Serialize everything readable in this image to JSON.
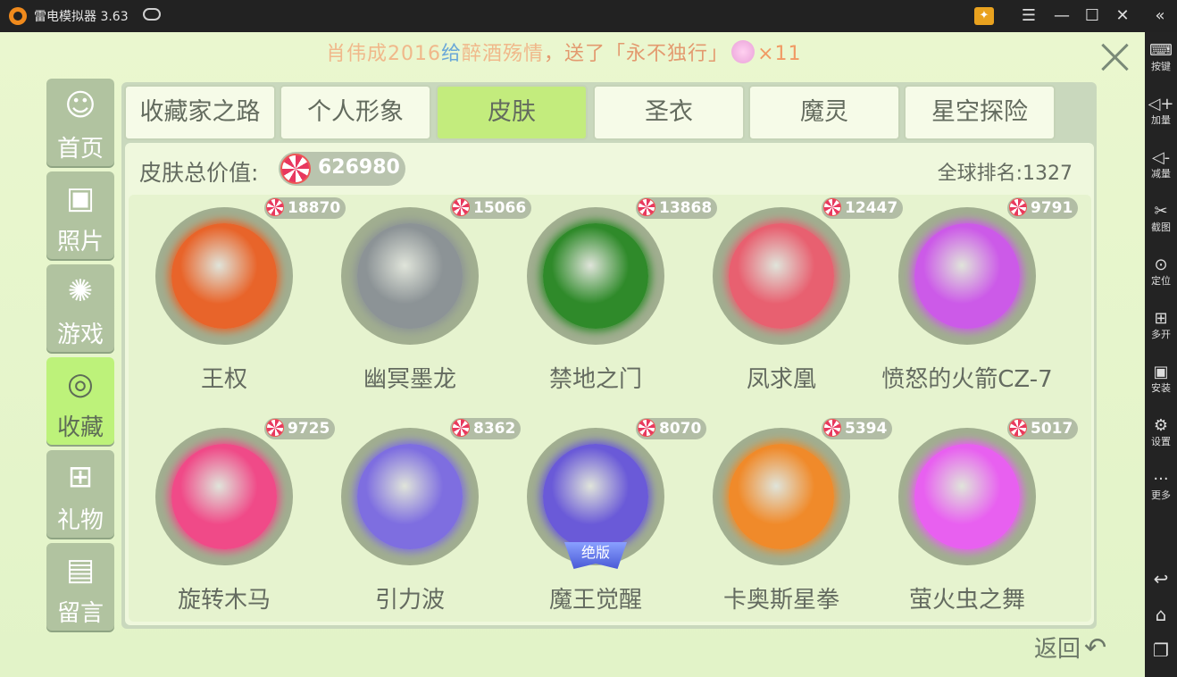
{
  "titlebar": {
    "title": "雷电模拟器 3.63"
  },
  "ticker": {
    "sender": "肖伟成2016",
    "connector": "给",
    "receiver": "醉酒殇情",
    "sent": "，送了",
    "gift": "「永不独行」",
    "count": "×11"
  },
  "menu": [
    {
      "label": "首页",
      "icon": "person-icon"
    },
    {
      "label": "照片",
      "icon": "photo-icon"
    },
    {
      "label": "游戏",
      "icon": "atom-icon"
    },
    {
      "label": "收藏",
      "icon": "gem-icon"
    },
    {
      "label": "礼物",
      "icon": "gift-icon"
    },
    {
      "label": "留言",
      "icon": "message-icon"
    }
  ],
  "tabs": [
    "收藏家之路",
    "个人形象",
    "皮肤",
    "圣衣",
    "魔灵",
    "星空探险"
  ],
  "summary": {
    "label": "皮肤总价值:",
    "value": "626980",
    "rank": "全球排名:1327"
  },
  "items": [
    {
      "name": "王权",
      "price": "18870",
      "color": "#e8642a"
    },
    {
      "name": "幽冥墨龙",
      "price": "15066",
      "color": "#8c9396"
    },
    {
      "name": "禁地之门",
      "price": "13868",
      "color": "#2f8a2a"
    },
    {
      "name": "凤求凰",
      "price": "12447",
      "color": "#e86070"
    },
    {
      "name": "愤怒的火箭CZ-7",
      "price": "9791",
      "color": "#cc5ae8"
    },
    {
      "name": "旋转木马",
      "price": "9725",
      "color": "#f04a88"
    },
    {
      "name": "引力波",
      "price": "8362",
      "color": "#7e6ee0"
    },
    {
      "name": "魔王觉醒",
      "price": "8070",
      "color": "#6a5ad8",
      "badge": "绝版"
    },
    {
      "name": "卡奥斯星拳",
      "price": "5394",
      "color": "#f08a2a"
    },
    {
      "name": "萤火虫之舞",
      "price": "5017",
      "color": "#e860f0"
    }
  ],
  "footer": {
    "return": "返回"
  },
  "rightbar": [
    {
      "label": "按键",
      "icon": "keyboard-icon"
    },
    {
      "label": "加量",
      "icon": "volume-up-icon"
    },
    {
      "label": "减量",
      "icon": "volume-down-icon"
    },
    {
      "label": "截图",
      "icon": "scissors-icon"
    },
    {
      "label": "定位",
      "icon": "location-icon"
    },
    {
      "label": "多开",
      "icon": "multi-open-icon"
    },
    {
      "label": "安装",
      "icon": "apk-icon"
    },
    {
      "label": "设置",
      "icon": "settings-icon"
    },
    {
      "label": "更多",
      "icon": "more-icon"
    }
  ],
  "colors": {
    "accent": "#c3ec7d",
    "panel": "#c9d8bd",
    "text": "#646b60"
  }
}
